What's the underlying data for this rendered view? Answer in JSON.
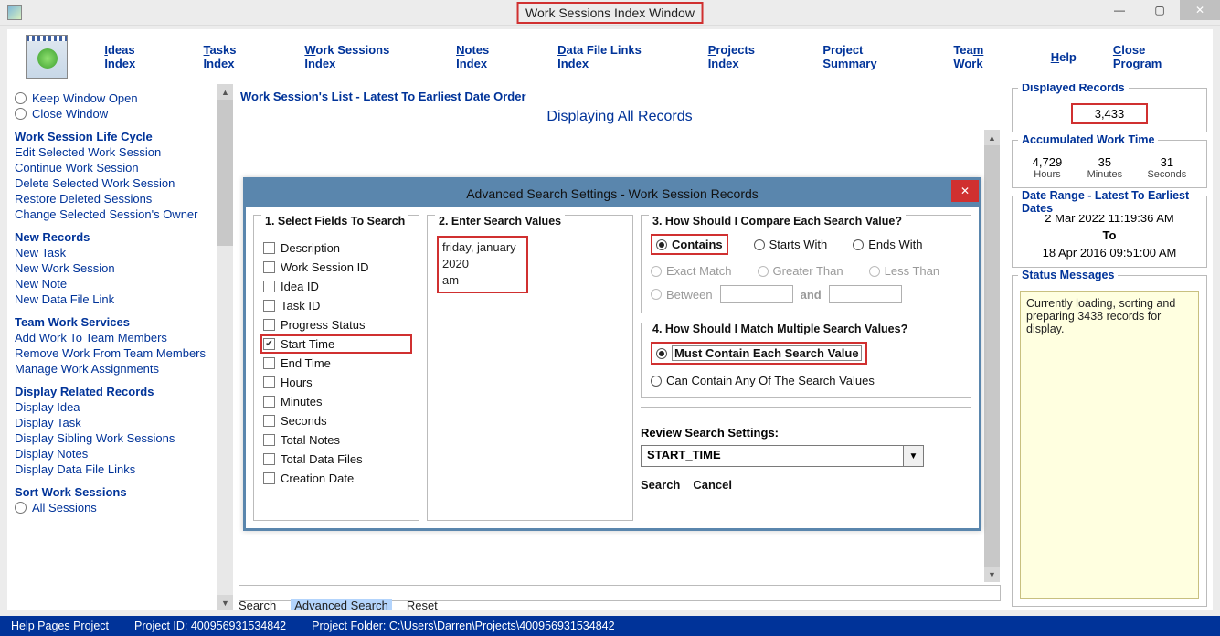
{
  "window": {
    "title": "Work Sessions Index Window"
  },
  "toolbar": {
    "items": [
      {
        "pre": "",
        "u": "I",
        "post": "deas Index"
      },
      {
        "pre": "",
        "u": "T",
        "post": "asks Index"
      },
      {
        "pre": "",
        "u": "W",
        "post": "ork Sessions Index"
      },
      {
        "pre": "",
        "u": "N",
        "post": "otes Index"
      },
      {
        "pre": "",
        "u": "D",
        "post": "ata File Links Index"
      },
      {
        "pre": "",
        "u": "P",
        "post": "rojects Index"
      },
      {
        "pre": "Project ",
        "u": "S",
        "post": "ummary"
      },
      {
        "pre": "Tea",
        "u": "m",
        "post": " Work"
      },
      {
        "pre": "",
        "u": "H",
        "post": "elp"
      },
      {
        "pre": "",
        "u": "C",
        "post": "lose Program"
      }
    ]
  },
  "sidebar": {
    "radios": {
      "keep": "Keep Window Open",
      "close": "Close Window"
    },
    "life_cycle_title": "Work Session Life Cycle",
    "life_cycle": [
      "Edit Selected Work Session",
      "Continue Work Session",
      "Delete Selected Work Session",
      "Restore Deleted Sessions",
      "Change Selected Session's Owner"
    ],
    "new_title": "New Records",
    "new_items": [
      "New Task",
      "New Work Session",
      "New Note",
      "New Data File Link"
    ],
    "team_title": "Team Work Services",
    "team_items": [
      "Add Work To Team Members",
      "Remove Work From Team Members",
      "Manage Work Assignments"
    ],
    "related_title": "Display Related Records",
    "related_items": [
      "Display Idea",
      "Display Task",
      "Display Sibling Work Sessions",
      "Display Notes",
      "Display Data File Links"
    ],
    "sort_title": "Sort Work Sessions",
    "sort_all": "All Sessions"
  },
  "list": {
    "header": "Work Session's List - Latest To Earliest Date Order",
    "subheader": "Displaying All Records"
  },
  "modal": {
    "title": "Advanced Search Settings - Work Session Records",
    "p1_title": "1. Select Fields To Search",
    "fields": [
      {
        "label": "Description",
        "checked": false
      },
      {
        "label": "Work Session ID",
        "checked": false
      },
      {
        "label": "Idea ID",
        "checked": false
      },
      {
        "label": "Task ID",
        "checked": false
      },
      {
        "label": "Progress Status",
        "checked": false
      },
      {
        "label": "Start Time",
        "checked": true,
        "highlight": true
      },
      {
        "label": "End Time",
        "checked": false
      },
      {
        "label": "Hours",
        "checked": false
      },
      {
        "label": "Minutes",
        "checked": false
      },
      {
        "label": "Seconds",
        "checked": false
      },
      {
        "label": "Total Notes",
        "checked": false
      },
      {
        "label": "Total Data Files",
        "checked": false
      },
      {
        "label": "Creation Date",
        "checked": false
      }
    ],
    "p2_title": "2. Enter Search Values",
    "search_values": [
      "friday, january",
      "2020",
      "am"
    ],
    "p3a_title": "3. How Should I Compare Each Search Value?",
    "compare": {
      "contains": "Contains",
      "starts": "Starts With",
      "ends": "Ends With",
      "exact": "Exact Match",
      "greater": "Greater Than",
      "less": "Less Than",
      "between": "Between",
      "and": "and"
    },
    "p3b_title": "4. How Should I Match Multiple Search Values?",
    "match": {
      "each": "Must Contain Each Search Value",
      "any": "Can Contain Any Of The Search Values"
    },
    "review_title": "Review Search Settings:",
    "dropdown_value": "START_TIME",
    "actions": {
      "search": "Search",
      "cancel": "Cancel"
    }
  },
  "right": {
    "displayed_title": "Displayed Records",
    "displayed_count": "3,433",
    "acc_title": "Accumulated Work Time",
    "acc": {
      "h": "4,729",
      "m": "35",
      "s": "31",
      "hl": "Hours",
      "ml": "Minutes",
      "sl": "Seconds"
    },
    "range_title": "Date Range - Latest To Earliest Dates",
    "range": {
      "from": "2 Mar 2022  11:19:36 AM",
      "to_label": "To",
      "to": "18 Apr 2016  09:51:00 AM"
    },
    "status_title": "Status Messages",
    "status_text": "Currently loading, sorting and preparing 3438 records for display."
  },
  "center_links": {
    "search": "Search",
    "adv": "Advanced Search",
    "reset": "Reset"
  },
  "statusbar": {
    "help": "Help Pages Project",
    "pid": "Project ID: 400956931534842",
    "pf": "Project Folder: C:\\Users\\Darren\\Projects\\400956931534842"
  }
}
